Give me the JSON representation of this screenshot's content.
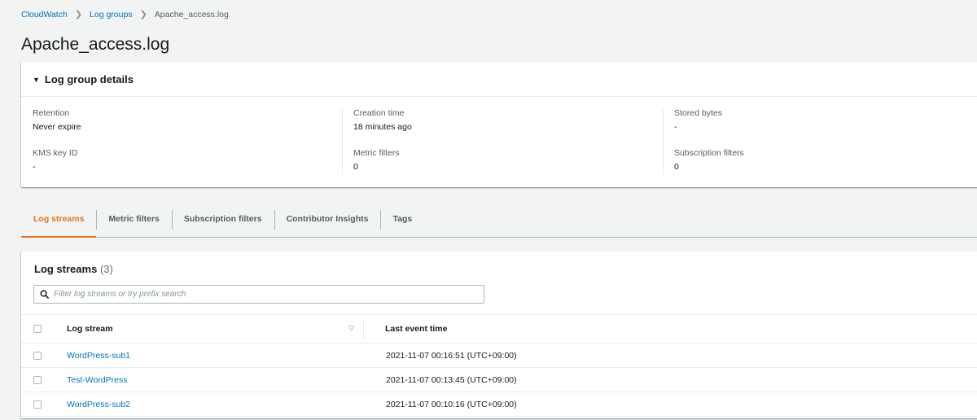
{
  "breadcrumb": {
    "items": [
      "CloudWatch",
      "Log groups"
    ],
    "current": "Apache_access.log",
    "separator": ">"
  },
  "page_title": "Apache_access.log",
  "details": {
    "title": "Log group details",
    "retention_label": "Retention",
    "retention_value": "Never expire",
    "kms_label": "KMS key ID",
    "kms_value": "-",
    "creation_label": "Creation time",
    "creation_value": "18 minutes ago",
    "metric_label": "Metric filters",
    "metric_value": "0",
    "stored_label": "Stored bytes",
    "stored_value": "-",
    "subscription_label": "Subscription filters",
    "subscription_value": "0"
  },
  "tabs": [
    "Log streams",
    "Metric filters",
    "Subscription filters",
    "Contributor Insights",
    "Tags"
  ],
  "streams": {
    "title": "Log streams",
    "count": "(3)",
    "search_placeholder": "Filter log streams or try prefix search",
    "col_stream": "Log stream",
    "col_time": "Last event time",
    "rows": [
      {
        "name": "WordPress-sub1",
        "time": "2021-11-07 00:16:51 (UTC+09:00)"
      },
      {
        "name": "Test-WordPress",
        "time": "2021-11-07 00:13:45 (UTC+09:00)"
      },
      {
        "name": "WordPress-sub2",
        "time": "2021-11-07 00:10:16 (UTC+09:00)"
      }
    ]
  },
  "colors": {
    "link": "#0073bb",
    "active_tab": "#ec7211",
    "background": "#f2f3f3"
  },
  "icons": [
    "search-icon",
    "caret-down-icon",
    "sort-icon",
    "breadcrumb-chevron-icon"
  ]
}
